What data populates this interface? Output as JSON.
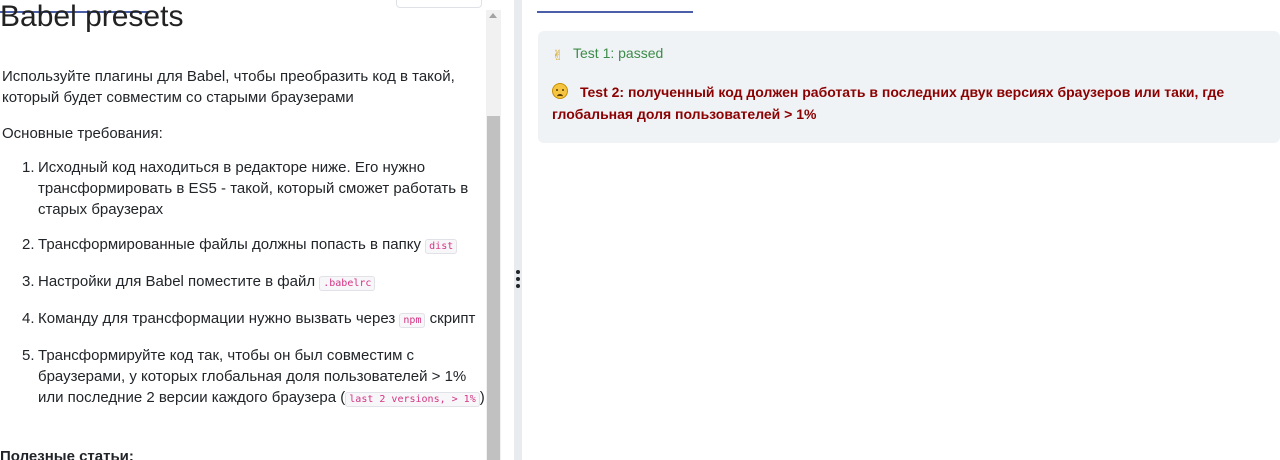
{
  "task": {
    "title": "Babel presets",
    "intro": "Используйте плагины для Babel, чтобы преобразить код в такой, который будет совместим со старыми браузерами",
    "requirements_label": "Основные требования:",
    "requirements": [
      {
        "num": "1.",
        "text": "Исходный код находиться в редакторе ниже. Его нужно трансформировать в ES5 - такой, который сможет работать в старых браузерах"
      },
      {
        "num": "2.",
        "before": "Трансформированные файлы должны попасть в папку",
        "code": "dist",
        "after": ""
      },
      {
        "num": "3.",
        "before": "Настройки для Babel поместите в файл",
        "code": ".babelrc",
        "after": ""
      },
      {
        "num": "4.",
        "before": "Команду для трансформации нужно вызвать через",
        "code": "npm",
        "after": "скрипт"
      },
      {
        "num": "5.",
        "before": "Трансформируйте код так, чтобы он был совместим с браузерами, у которых глобальная доля пользователей > 1% или последние 2 версии каждого браузера (",
        "code": "last 2 versions, > 1%",
        "after": ")"
      }
    ],
    "articles_heading": "Полезные статьи:"
  },
  "results": {
    "test1": "Test 1: passed",
    "test2": "Test 2: полученный код должен работать в последних двук версиях браузеров или таки, где глобальная доля пользователей > 1%"
  },
  "icons": {
    "test1_icon": "ok-hand-icon",
    "test2_icon": "sad-face-icon"
  },
  "colors": {
    "pass": "#3d8b4a",
    "fail": "#8b0000",
    "code": "#d63384",
    "accent": "#4a5fa8"
  }
}
